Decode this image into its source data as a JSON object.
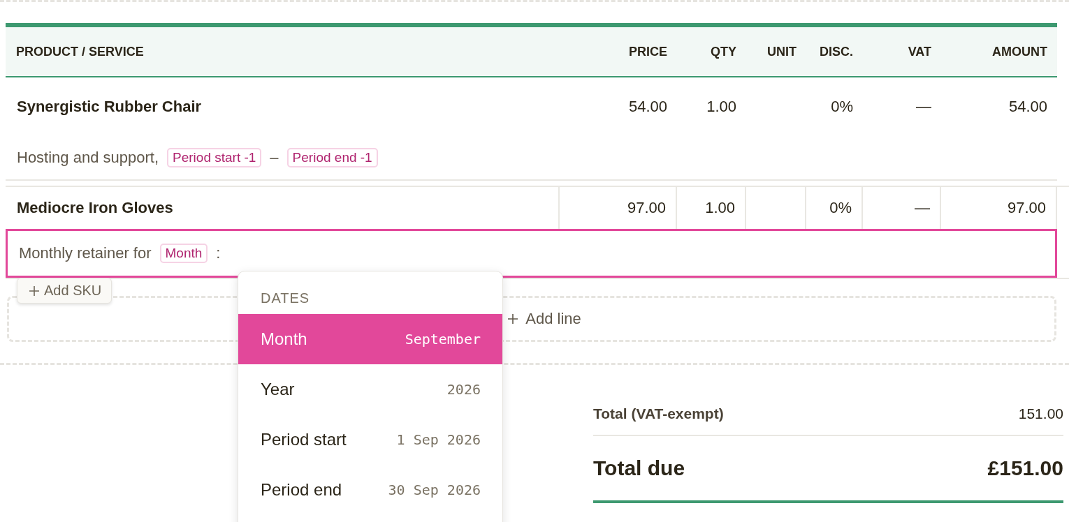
{
  "columns": [
    {
      "label": "PRODUCT / SERVICE"
    },
    {
      "label": "PRICE"
    },
    {
      "label": "QTY"
    },
    {
      "label": "UNIT"
    },
    {
      "label": "DISC."
    },
    {
      "label": "VAT"
    },
    {
      "label": "AMOUNT"
    }
  ],
  "rows": [
    {
      "name": "Synergistic Rubber Chair",
      "price": "54.00",
      "qty": "1.00",
      "disc": "0%",
      "vat": "—",
      "amount": "54.00",
      "editing": false,
      "description": [
        {
          "kind": "text",
          "text": "Hosting and support,"
        },
        {
          "kind": "token",
          "text": "Period start -1"
        },
        {
          "kind": "text",
          "text": "–"
        },
        {
          "kind": "token",
          "text": "Period end -1"
        }
      ]
    },
    {
      "name": "Mediocre Iron Gloves",
      "price": "97.00",
      "qty": "1.00",
      "disc": "0%",
      "vat": "—",
      "amount": "97.00",
      "editing": true,
      "description": [
        {
          "kind": "text",
          "text": "Monthly retainer for"
        },
        {
          "kind": "token",
          "text": "Month"
        },
        {
          "kind": "text",
          "text": ":"
        }
      ]
    }
  ],
  "add_sku_button": {
    "label": "Add SKU"
  },
  "add_line_button": {
    "label": "Add line"
  },
  "dropdown": {
    "heading": "DATES",
    "items": [
      {
        "label": "Month",
        "value": "September",
        "selected": true
      },
      {
        "label": "Year",
        "value": "2026",
        "selected": false
      },
      {
        "label": "Period start",
        "value": "1 Sep 2026",
        "selected": false
      },
      {
        "label": "Period end",
        "value": "30 Sep 2026",
        "selected": false
      }
    ]
  },
  "totals": [
    {
      "kind": "subtotal",
      "label": "Total (VAT-exempt)",
      "value": "151.00"
    },
    {
      "kind": "due",
      "label": "Total due",
      "value": "£151.00"
    }
  ]
}
